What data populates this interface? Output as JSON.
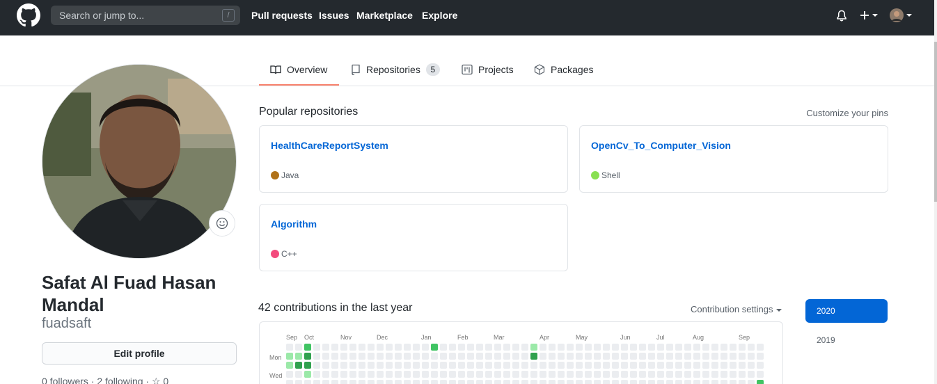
{
  "header": {
    "search_placeholder": "Search or jump to...",
    "search_shortcut": "/",
    "nav": [
      "Pull requests",
      "Issues",
      "Marketplace",
      "Explore"
    ]
  },
  "tabs": {
    "overview": "Overview",
    "repositories": "Repositories",
    "repositories_count": "5",
    "projects": "Projects",
    "packages": "Packages"
  },
  "profile": {
    "fullname": "Safat Al Fuad Hasan Mandal",
    "username": "fuadsaft",
    "edit_button": "Edit profile",
    "follow_line": "0 followers · 2 following · ☆ 0"
  },
  "popular": {
    "title": "Popular repositories",
    "customize": "Customize your pins",
    "repos": [
      {
        "name": "HealthCareReportSystem",
        "language": "Java",
        "color": "#b07219"
      },
      {
        "name": "OpenCv_To_Computer_Vision",
        "language": "Shell",
        "color": "#89e051"
      },
      {
        "name": "Algorithm",
        "language": "C++",
        "color": "#f34b7d"
      }
    ]
  },
  "contributions": {
    "title": "42 contributions in the last year",
    "settings": "Contribution settings",
    "months": [
      "Sep",
      "Oct",
      "Nov",
      "Dec",
      "Jan",
      "Feb",
      "Mar",
      "Apr",
      "May",
      "Jun",
      "Jul",
      "Aug",
      "Sep"
    ],
    "days": [
      "Mon",
      "Wed"
    ],
    "years": [
      "2020",
      "2019"
    ],
    "colors": {
      "empty": "#ebedf0",
      "l1": "#9be9a8",
      "l2": "#40c463",
      "l3": "#30a14e"
    }
  }
}
